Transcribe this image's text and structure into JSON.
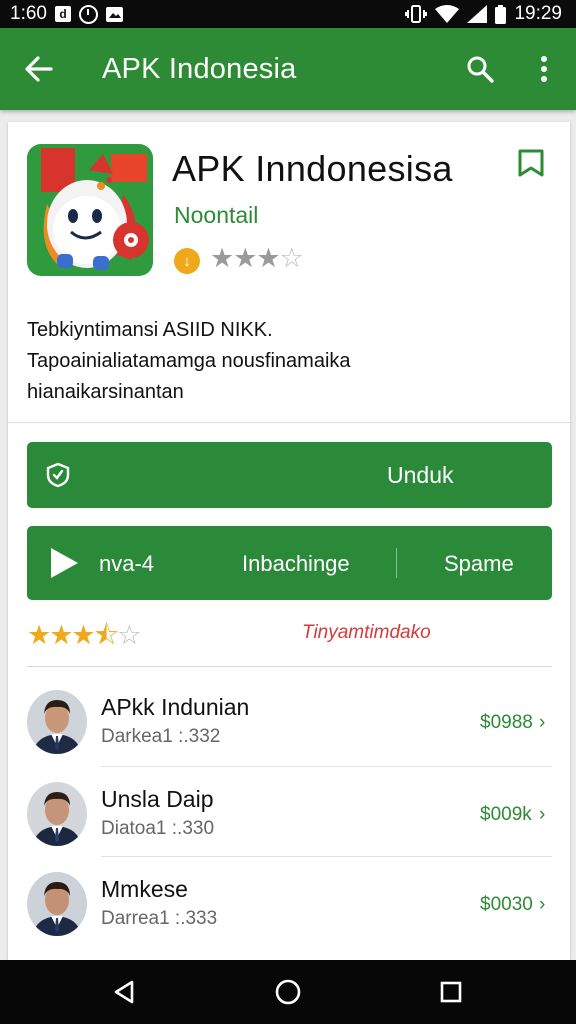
{
  "status_bar": {
    "time_left": "1:60",
    "time_right": "19:29",
    "box_glyph": "d"
  },
  "toolbar": {
    "title": "APK Indonesia",
    "back_icon": "arrow-back-icon",
    "search_icon": "search-icon",
    "more_icon": "more-vert-icon"
  },
  "app": {
    "title": "APK Inndonesisa",
    "developer": "Noontail",
    "rating_stars": "★★★",
    "rating_empty": "☆",
    "download_badge": "↓",
    "description_lines": [
      "Tebkiyntimansi ASIID NIKK.",
      "Tapoainialiatamamga nousfinamaika",
      "hianaikarsinantan"
    ]
  },
  "buttons": {
    "unduh_label": "Unduk",
    "play_label": "nva-4",
    "install_label": "Inbachinge",
    "share_label": "Spame"
  },
  "rating_row": {
    "stars": "★★★⯪",
    "empty": "☆",
    "link_label": "Tinyamtimdako"
  },
  "colors": {
    "primary_green": "#2e8b35",
    "button_green": "#2b8a3a",
    "accent_orange": "#f0a91a",
    "link_red": "#d33b3b"
  },
  "list": [
    {
      "name": "APkk Indunian",
      "sub": "Darkea1 :.332",
      "price": "$0988",
      "chevron": "›"
    },
    {
      "name": "Unsla Daip",
      "sub": "Diatoa1 :.330",
      "price": "$009k",
      "chevron": "›"
    },
    {
      "name": "Mmkese",
      "sub": "Darrea1 :.333",
      "price": "$0030",
      "chevron": "›"
    }
  ],
  "nav": {
    "back": "nav-back-icon",
    "home": "nav-home-icon",
    "recents": "nav-recents-icon"
  }
}
